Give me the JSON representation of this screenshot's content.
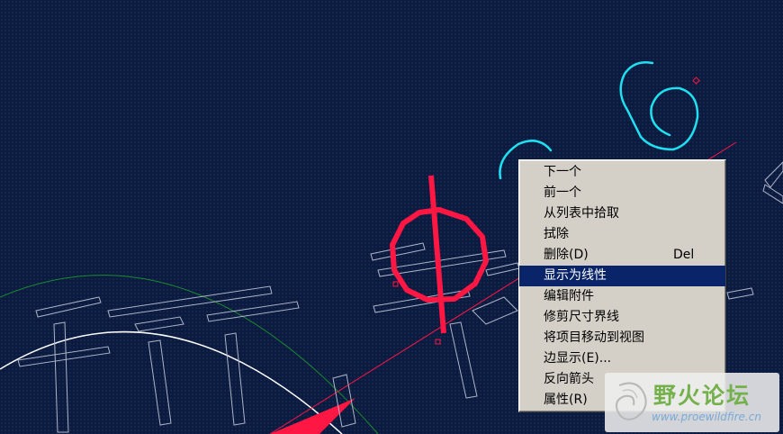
{
  "context_menu": {
    "items": [
      {
        "label": "下一个",
        "shortcut": ""
      },
      {
        "label": "前一个",
        "shortcut": ""
      },
      {
        "label": "从列表中拾取",
        "shortcut": ""
      },
      {
        "label": "拭除",
        "shortcut": ""
      },
      {
        "label": "删除(D)",
        "shortcut": "Del"
      },
      {
        "label": "显示为线性",
        "shortcut": "",
        "selected": true
      },
      {
        "label": "编辑附件",
        "shortcut": ""
      },
      {
        "label": "修剪尺寸界线",
        "shortcut": ""
      },
      {
        "label": "将项目移动到视图",
        "shortcut": ""
      },
      {
        "label": "边显示(E)...",
        "shortcut": ""
      },
      {
        "label": "反向箭头",
        "shortcut": ""
      },
      {
        "label": "属性(R)",
        "shortcut": ""
      }
    ]
  },
  "watermark": {
    "title": "野火论坛",
    "url": "www.proewildfire.cn"
  },
  "colors": {
    "background": "#0b1a3f",
    "highlight": "#0a246a",
    "red_symbol": "#ff1744",
    "cyan_text": "#1fe0f0",
    "green_arc": "#1a8c2e"
  },
  "icons": [
    "watermark-logo-icon"
  ]
}
